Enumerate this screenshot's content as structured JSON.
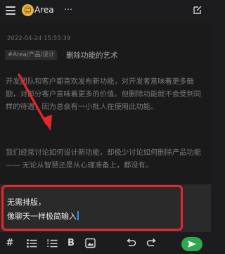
{
  "header": {
    "space_name": "Area",
    "avatar_emoji": "😊",
    "more_glyph": "⋯"
  },
  "memo": {
    "timestamp": "2022-04-24 15:55:39",
    "tag": "#Area/产品/设计",
    "title": "删除功能的艺术",
    "paragraph1": "开发团队和客户都喜欢发布新功能，对开发者意味着更多鼓励，对部分客户意味着更多的价值。但删除功能就不会受到同样的待遇，因为总会有一小批人在使用此功能。",
    "paragraph2": "我们经常讨论如何设计新功能，却极少讨论如何删除产品功能 —— 无论从智慧还是从心理准备上，都没有。"
  },
  "composer": {
    "line1": "无需排版，",
    "line2": "像聊天一样极简输入"
  },
  "toolbar": {
    "hash": "#",
    "bold": "B",
    "items": [
      "hash-icon",
      "bullet-list-icon",
      "numbered-list-icon",
      "bold-icon",
      "image-icon",
      "undo-icon",
      "redo-icon",
      "send-icon"
    ]
  },
  "colors": {
    "background": "#1c1c1e",
    "accent_send": "#2fa84f",
    "annotation_red": "#e8262c",
    "caret": "#2f8df5"
  }
}
